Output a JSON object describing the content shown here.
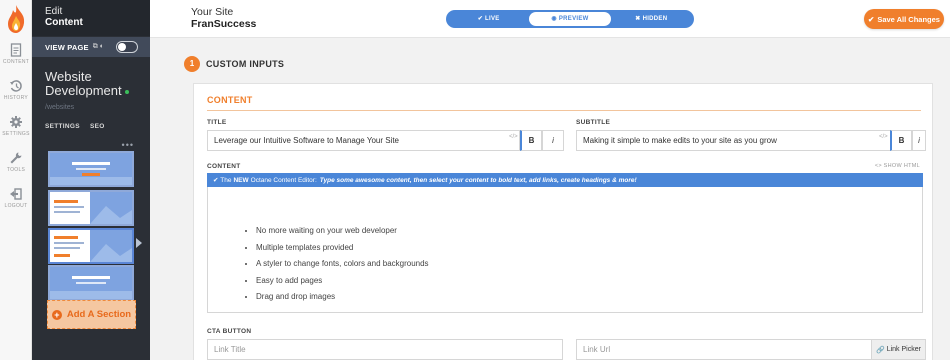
{
  "rail": {
    "items": [
      {
        "label": "CONTENT",
        "icon": "document-icon"
      },
      {
        "label": "HISTORY",
        "icon": "history-icon"
      },
      {
        "label": "SETTINGS",
        "icon": "gear-icon"
      },
      {
        "label": "TOOLS",
        "icon": "wrench-icon"
      },
      {
        "label": "LOGOUT",
        "icon": "logout-icon"
      }
    ]
  },
  "panel": {
    "head_line1": "Edit",
    "head_line2": "Content",
    "view_page_label": "VIEW PAGE",
    "site_title": "Website Development",
    "site_path": "/websites",
    "tabs": [
      "SETTINGS",
      "SEO"
    ],
    "add_section_label": "Add A Section"
  },
  "topbar": {
    "site_line1": "Your Site",
    "site_line2": "FranSuccess",
    "modes": [
      "LIVE",
      "PREVIEW",
      "HIDDEN"
    ],
    "active_mode": "PREVIEW",
    "save_label": "Save All Changes"
  },
  "main": {
    "section_number": "1",
    "section_title": "CUSTOM INPUTS",
    "card_title": "CONTENT",
    "title_label": "TITLE",
    "title_value": "Leverage our Intuitive Software to Manage Your Site",
    "subtitle_label": "SUBTITLE",
    "subtitle_value": "Making it simple to make edits to your site as you grow",
    "content_label": "CONTENT",
    "show_html": "<> SHOW HTML",
    "editor_notice_pre": "The",
    "editor_notice_new": "NEW",
    "editor_notice_mid": "Octane Content Editor:",
    "editor_notice_tip": "Type some awesome content, then select your content to bold text, add links, create headings & more!",
    "bullets": [
      "No more waiting on your web developer",
      "Multiple templates provided",
      "A styler to change fonts, colors and backgrounds",
      "Easy to add pages",
      "Drag and drop images"
    ],
    "cta_label": "CTA BUTTON",
    "link_title_placeholder": "Link Title",
    "link_url_placeholder": "Link Url",
    "link_picker_label": "Link Picker",
    "bold_label": "B",
    "italic_label": "i",
    "code_tag": "</>"
  },
  "colors": {
    "accent_orange": "#f07f2c",
    "accent_blue": "#4a86d8",
    "panel_dark": "#2b2f36"
  }
}
